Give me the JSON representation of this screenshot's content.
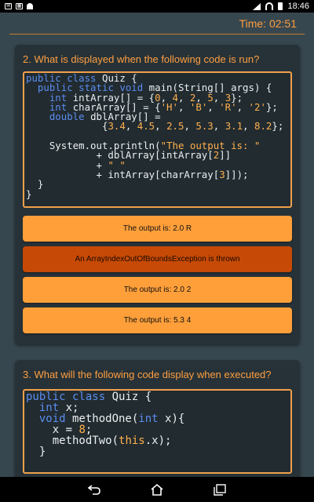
{
  "status_bar": {
    "time": "18:46",
    "notifications": [
      "mail-icon",
      "gallery-icon",
      "android-icon"
    ],
    "system": [
      "signal-icon",
      "wifi-icon",
      "battery-icon"
    ]
  },
  "timer": {
    "text": "Time: 02:51"
  },
  "questions": [
    {
      "title": "2. What is displayed when the following code is run?",
      "options": [
        {
          "label": "The output is: 2.0 R",
          "selected": false
        },
        {
          "label": "An ArrayIndexOutOfBoundsException is thrown",
          "selected": true
        },
        {
          "label": "The output is: 2.0 2",
          "selected": false
        },
        {
          "label": "The output is: 5.3 4",
          "selected": false
        }
      ]
    },
    {
      "title": "3. What will the following code display when executed?",
      "options": []
    }
  ],
  "nav_bar": {
    "buttons": [
      "back-icon",
      "home-icon",
      "recents-icon"
    ]
  },
  "colors": {
    "background": "#37474f",
    "card": "#263238",
    "accent": "#ff9e40",
    "option": "#ff9f3a",
    "option_selected": "#c64a05",
    "code_keyword": "#5b8def"
  }
}
